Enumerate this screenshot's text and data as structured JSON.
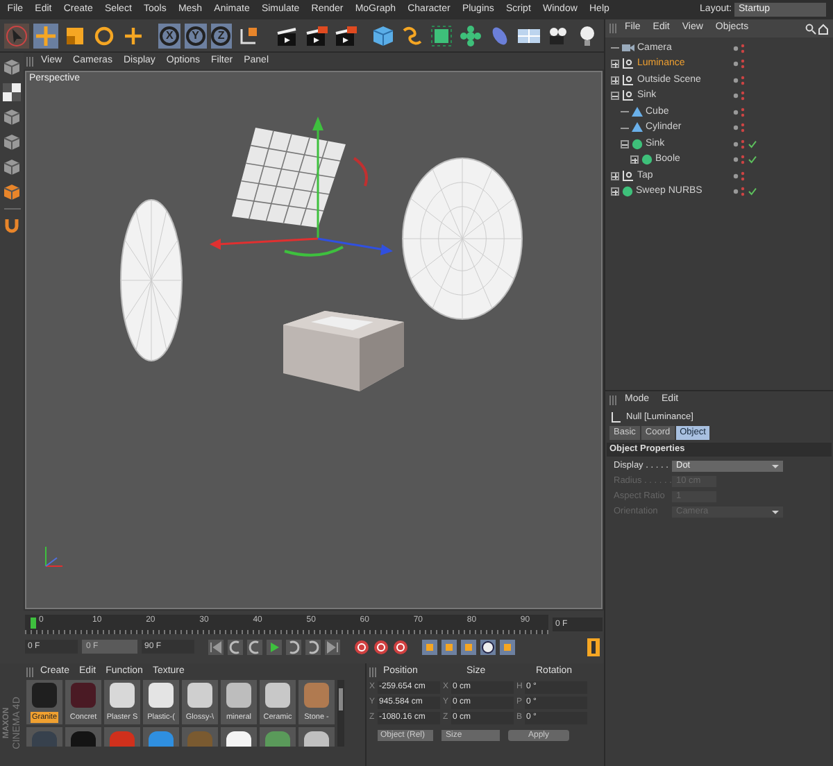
{
  "menu": [
    "File",
    "Edit",
    "Create",
    "Select",
    "Tools",
    "Mesh",
    "Animate",
    "Simulate",
    "Render",
    "MoGraph",
    "Character",
    "Plugins",
    "Script",
    "Window",
    "Help"
  ],
  "layout": {
    "label": "Layout:",
    "value": "Startup"
  },
  "toolbar": {
    "axis_buttons": [
      {
        "label": "X",
        "selected": true
      },
      {
        "label": "Y",
        "selected": true
      },
      {
        "label": "Z",
        "selected": true
      }
    ]
  },
  "viewport": {
    "menu": [
      "View",
      "Cameras",
      "Display",
      "Options",
      "Filter",
      "Panel"
    ],
    "camera": "Perspective"
  },
  "timeline": {
    "ticks": [
      "0",
      "10",
      "20",
      "30",
      "40",
      "50",
      "60",
      "70",
      "80",
      "90"
    ],
    "level": 0,
    "current": "0 F",
    "start": "0 F",
    "preview_start": "0 F",
    "end": "90 F"
  },
  "object_manager": {
    "menu": [
      "File",
      "Edit",
      "View",
      "Objects"
    ],
    "items": [
      {
        "name": "Camera",
        "kind": "camera",
        "selected": false,
        "checked": false
      },
      {
        "name": "Luminance",
        "kind": "null",
        "selected": true,
        "checked": false,
        "expanded": false
      },
      {
        "name": "Outside Scene",
        "kind": "null",
        "selected": false,
        "checked": false,
        "expanded": false
      },
      {
        "name": "Sink",
        "kind": "null",
        "selected": false,
        "checked": false,
        "expanded": true,
        "children": [
          {
            "name": "Cube",
            "kind": "primitive",
            "selected": false,
            "checked": false
          },
          {
            "name": "Cylinder",
            "kind": "primitive",
            "selected": false,
            "checked": false
          },
          {
            "name": "Sink",
            "kind": "generator",
            "selected": false,
            "checked": true,
            "expanded": true,
            "children": [
              {
                "name": "Boole",
                "kind": "generator",
                "selected": false,
                "checked": true,
                "expanded": false
              }
            ]
          }
        ]
      },
      {
        "name": "Tap",
        "kind": "null",
        "selected": false,
        "checked": false,
        "expanded": false
      },
      {
        "name": "Sweep NURBS",
        "kind": "generator",
        "selected": false,
        "checked": true,
        "expanded": false
      }
    ]
  },
  "attributes": {
    "menu": [
      "Mode",
      "Edit"
    ],
    "title": "Null [Luminance]",
    "tabs": [
      {
        "label": "Basic",
        "selected": false
      },
      {
        "label": "Coord",
        "selected": false
      },
      {
        "label": "Object",
        "selected": true
      }
    ],
    "section": "Object Properties",
    "fields": [
      {
        "label": "Display . . . . .",
        "value": "Dot",
        "kind": "dropdown",
        "disabled": false
      },
      {
        "label": "Radius . . . . . .",
        "value": "10 cm",
        "kind": "number",
        "disabled": true
      },
      {
        "label": "Aspect Ratio",
        "value": "1",
        "kind": "number",
        "disabled": true
      },
      {
        "label": "Orientation",
        "value": "Camera",
        "kind": "dropdown",
        "disabled": true
      }
    ]
  },
  "materials": {
    "menu": [
      "Create",
      "Edit",
      "Function",
      "Texture"
    ],
    "items": [
      {
        "name": "Granite",
        "selected": true,
        "color": "#1f1f1f"
      },
      {
        "name": "Concret",
        "selected": false,
        "color": "#4a1a24"
      },
      {
        "name": "Plaster S",
        "selected": false,
        "color": "#d8d8d8"
      },
      {
        "name": "Plastic-(",
        "selected": false,
        "color": "#e4e4e4"
      },
      {
        "name": "Glossy-\\",
        "selected": false,
        "color": "#cfcfcf"
      },
      {
        "name": "mineral",
        "selected": false,
        "color": "#bdbdbd"
      },
      {
        "name": "Ceramic",
        "selected": false,
        "color": "#c8c8c8"
      },
      {
        "name": "Stone -",
        "selected": false,
        "color": "#b07a50"
      }
    ],
    "swatches": [
      {
        "color": "#37414d"
      },
      {
        "color": "#141414"
      },
      {
        "color": "#d0301c"
      },
      {
        "color": "#2f8fe0"
      },
      {
        "color": "#7a5a30"
      },
      {
        "color": "#f4f4f4"
      },
      {
        "color": "#5a9a5a"
      },
      {
        "color": "#c0c0c0"
      }
    ]
  },
  "coordinates": {
    "headers": [
      "Position",
      "Size",
      "Rotation"
    ],
    "rows": [
      {
        "cells": [
          {
            "axis": "X",
            "value": "-259.654 cm"
          },
          {
            "axis": "X",
            "value": "0 cm"
          },
          {
            "axis": "H",
            "value": "0 °"
          }
        ]
      },
      {
        "cells": [
          {
            "axis": "Y",
            "value": "945.584 cm"
          },
          {
            "axis": "Y",
            "value": "0 cm"
          },
          {
            "axis": "P",
            "value": "0 °"
          }
        ]
      },
      {
        "cells": [
          {
            "axis": "Z",
            "value": "-1080.16 cm"
          },
          {
            "axis": "Z",
            "value": "0 cm"
          },
          {
            "axis": "B",
            "value": "0 °"
          }
        ]
      }
    ],
    "mode": "Object (Rel)",
    "size_mode": "Size",
    "apply": "Apply"
  },
  "brand": [
    "MAXON",
    "CINEMA 4D"
  ]
}
